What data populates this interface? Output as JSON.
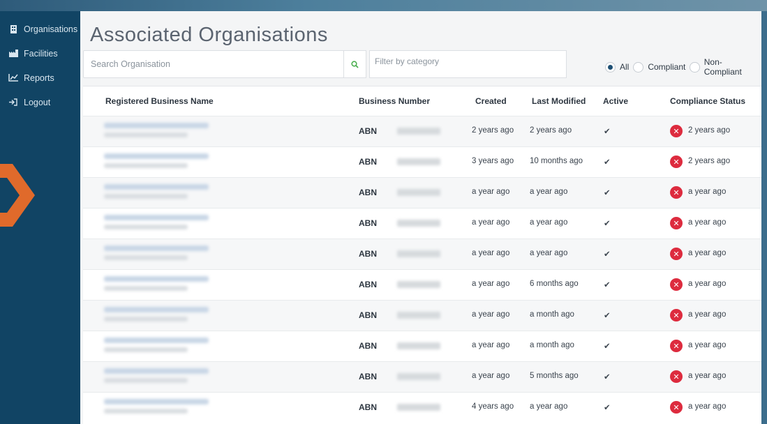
{
  "sidebar": {
    "items": [
      {
        "label": "Organisations",
        "icon": "building-icon"
      },
      {
        "label": "Facilities",
        "icon": "factory-icon"
      },
      {
        "label": "Reports",
        "icon": "chart-icon"
      },
      {
        "label": "Logout",
        "icon": "logout-icon"
      }
    ]
  },
  "page": {
    "title": "Associated Organisations",
    "search_placeholder": "Search Organisation",
    "filter_placeholder": "Filter by category"
  },
  "filters": {
    "options": [
      "All",
      "Compliant",
      "Non-Compliant"
    ],
    "selected": "All"
  },
  "table": {
    "headers": [
      "Registered Business Name",
      "Business Number",
      "Created",
      "Last Modified",
      "Active",
      "Compliance Status"
    ],
    "rows": [
      {
        "abn": "ABN",
        "created": "2 years ago",
        "modified": "2 years ago",
        "active": "✔",
        "status": "2 years ago"
      },
      {
        "abn": "ABN",
        "created": "3 years ago",
        "modified": "10 months ago",
        "active": "✔",
        "status": "2 years ago"
      },
      {
        "abn": "ABN",
        "created": "a year ago",
        "modified": "a year ago",
        "active": "✔",
        "status": "a year ago"
      },
      {
        "abn": "ABN",
        "created": "a year ago",
        "modified": "a year ago",
        "active": "✔",
        "status": "a year ago"
      },
      {
        "abn": "ABN",
        "created": "a year ago",
        "modified": "a year ago",
        "active": "✔",
        "status": "a year ago"
      },
      {
        "abn": "ABN",
        "created": "a year ago",
        "modified": "6 months ago",
        "active": "✔",
        "status": "a year ago"
      },
      {
        "abn": "ABN",
        "created": "a year ago",
        "modified": "a month ago",
        "active": "✔",
        "status": "a year ago"
      },
      {
        "abn": "ABN",
        "created": "a year ago",
        "modified": "a month ago",
        "active": "✔",
        "status": "a year ago"
      },
      {
        "abn": "ABN",
        "created": "a year ago",
        "modified": "5 months ago",
        "active": "✔",
        "status": "a year ago"
      },
      {
        "abn": "ABN",
        "created": "4 years ago",
        "modified": "a year ago",
        "active": "✔",
        "status": "a year ago"
      }
    ]
  },
  "colors": {
    "sidebar": "#114464",
    "accent": "#1d4f73",
    "noncompliant": "#dd2b3e",
    "arrow": "#e06a2b",
    "search_icon": "#4caf50"
  }
}
